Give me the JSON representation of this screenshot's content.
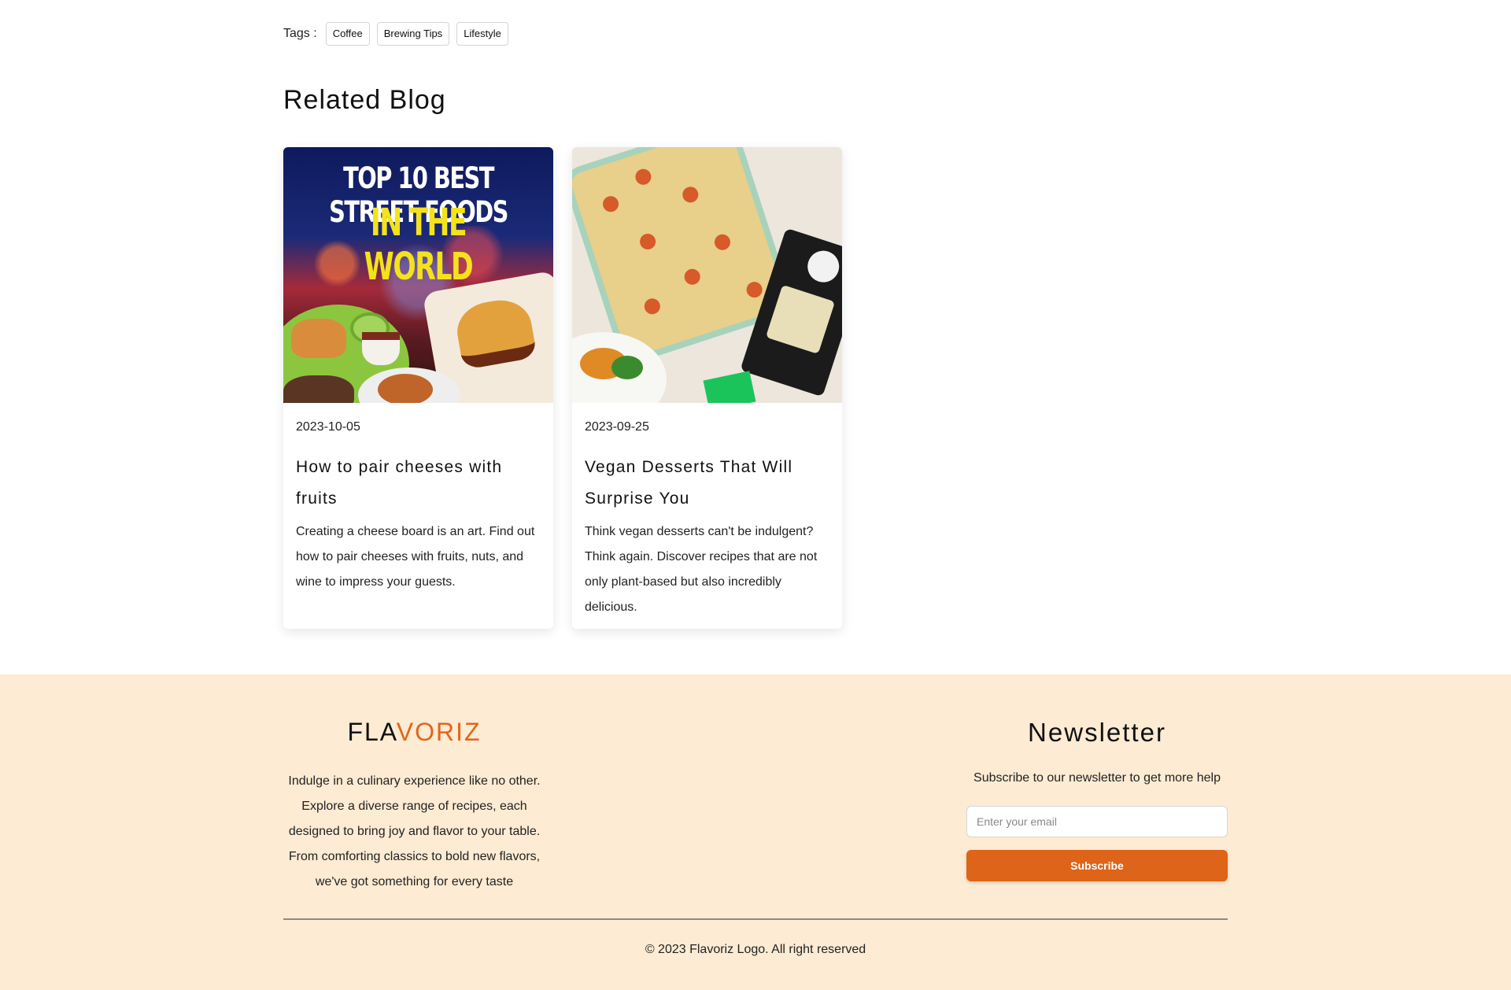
{
  "tags": {
    "label": "Tags :",
    "items": [
      "Coffee",
      "Brewing Tips",
      "Lifestyle"
    ]
  },
  "related": {
    "title": "Related Blog",
    "cards": [
      {
        "image_headline_1": "TOP 10 BEST STREET FOODS",
        "image_headline_2": "IN THE WORLD",
        "date": "2023-10-05",
        "title": "How to pair cheeses with fruits",
        "excerpt": "Creating a cheese board is an art. Find out how to pair cheeses with fruits, nuts, and wine to impress your guests."
      },
      {
        "date": "2023-09-25",
        "title": "Vegan Desserts That Will Surprise You",
        "excerpt": "Think vegan desserts can't be indulgent? Think again. Discover recipes that are not only plant-based but also incredibly delicious."
      }
    ]
  },
  "footer": {
    "brand_part1": "FLA",
    "brand_part2": "VORIZ",
    "about": "Indulge in a culinary experience like no other. Explore a diverse range of recipes, each designed to bring joy and flavor to your table. From comforting classics to bold new flavors, we've got something for every taste",
    "newsletter": {
      "title": "Newsletter",
      "description": "Subscribe to our newsletter to get more help",
      "placeholder": "Enter your email",
      "button_label": "Subscribe"
    },
    "copyright": "© 2023 Flavoriz Logo. All right reserved"
  },
  "colors": {
    "accent": "#de6419",
    "footer_bg": "#fdebd3"
  }
}
